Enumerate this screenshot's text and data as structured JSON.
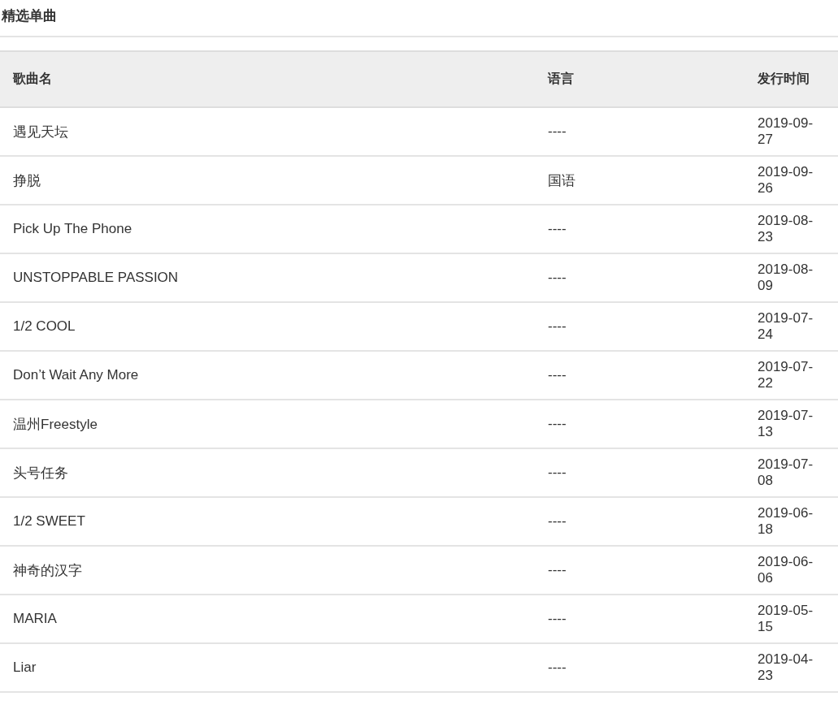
{
  "title": "精选单曲",
  "table": {
    "columns": [
      "歌曲名",
      "语言",
      "发行时间"
    ],
    "rows": [
      [
        "遇见天坛",
        "----",
        "2019-09-27"
      ],
      [
        "挣脱",
        "国语",
        "2019-09-26"
      ],
      [
        "Pick Up The Phone",
        "----",
        "2019-08-23"
      ],
      [
        "UNSTOPPABLE PASSION",
        "----",
        "2019-08-09"
      ],
      [
        "1/2 COOL",
        "----",
        "2019-07-24"
      ],
      [
        "Don’t Wait Any More",
        "----",
        "2019-07-22"
      ],
      [
        "温州Freestyle",
        "----",
        "2019-07-13"
      ],
      [
        "头号任务",
        "----",
        "2019-07-08"
      ],
      [
        "1/2 SWEET",
        "----",
        "2019-06-18"
      ],
      [
        "神奇的汉字",
        "----",
        "2019-06-06"
      ],
      [
        "MARIA",
        "----",
        "2019-05-15"
      ],
      [
        "Liar",
        "----",
        "2019-04-23"
      ]
    ]
  }
}
